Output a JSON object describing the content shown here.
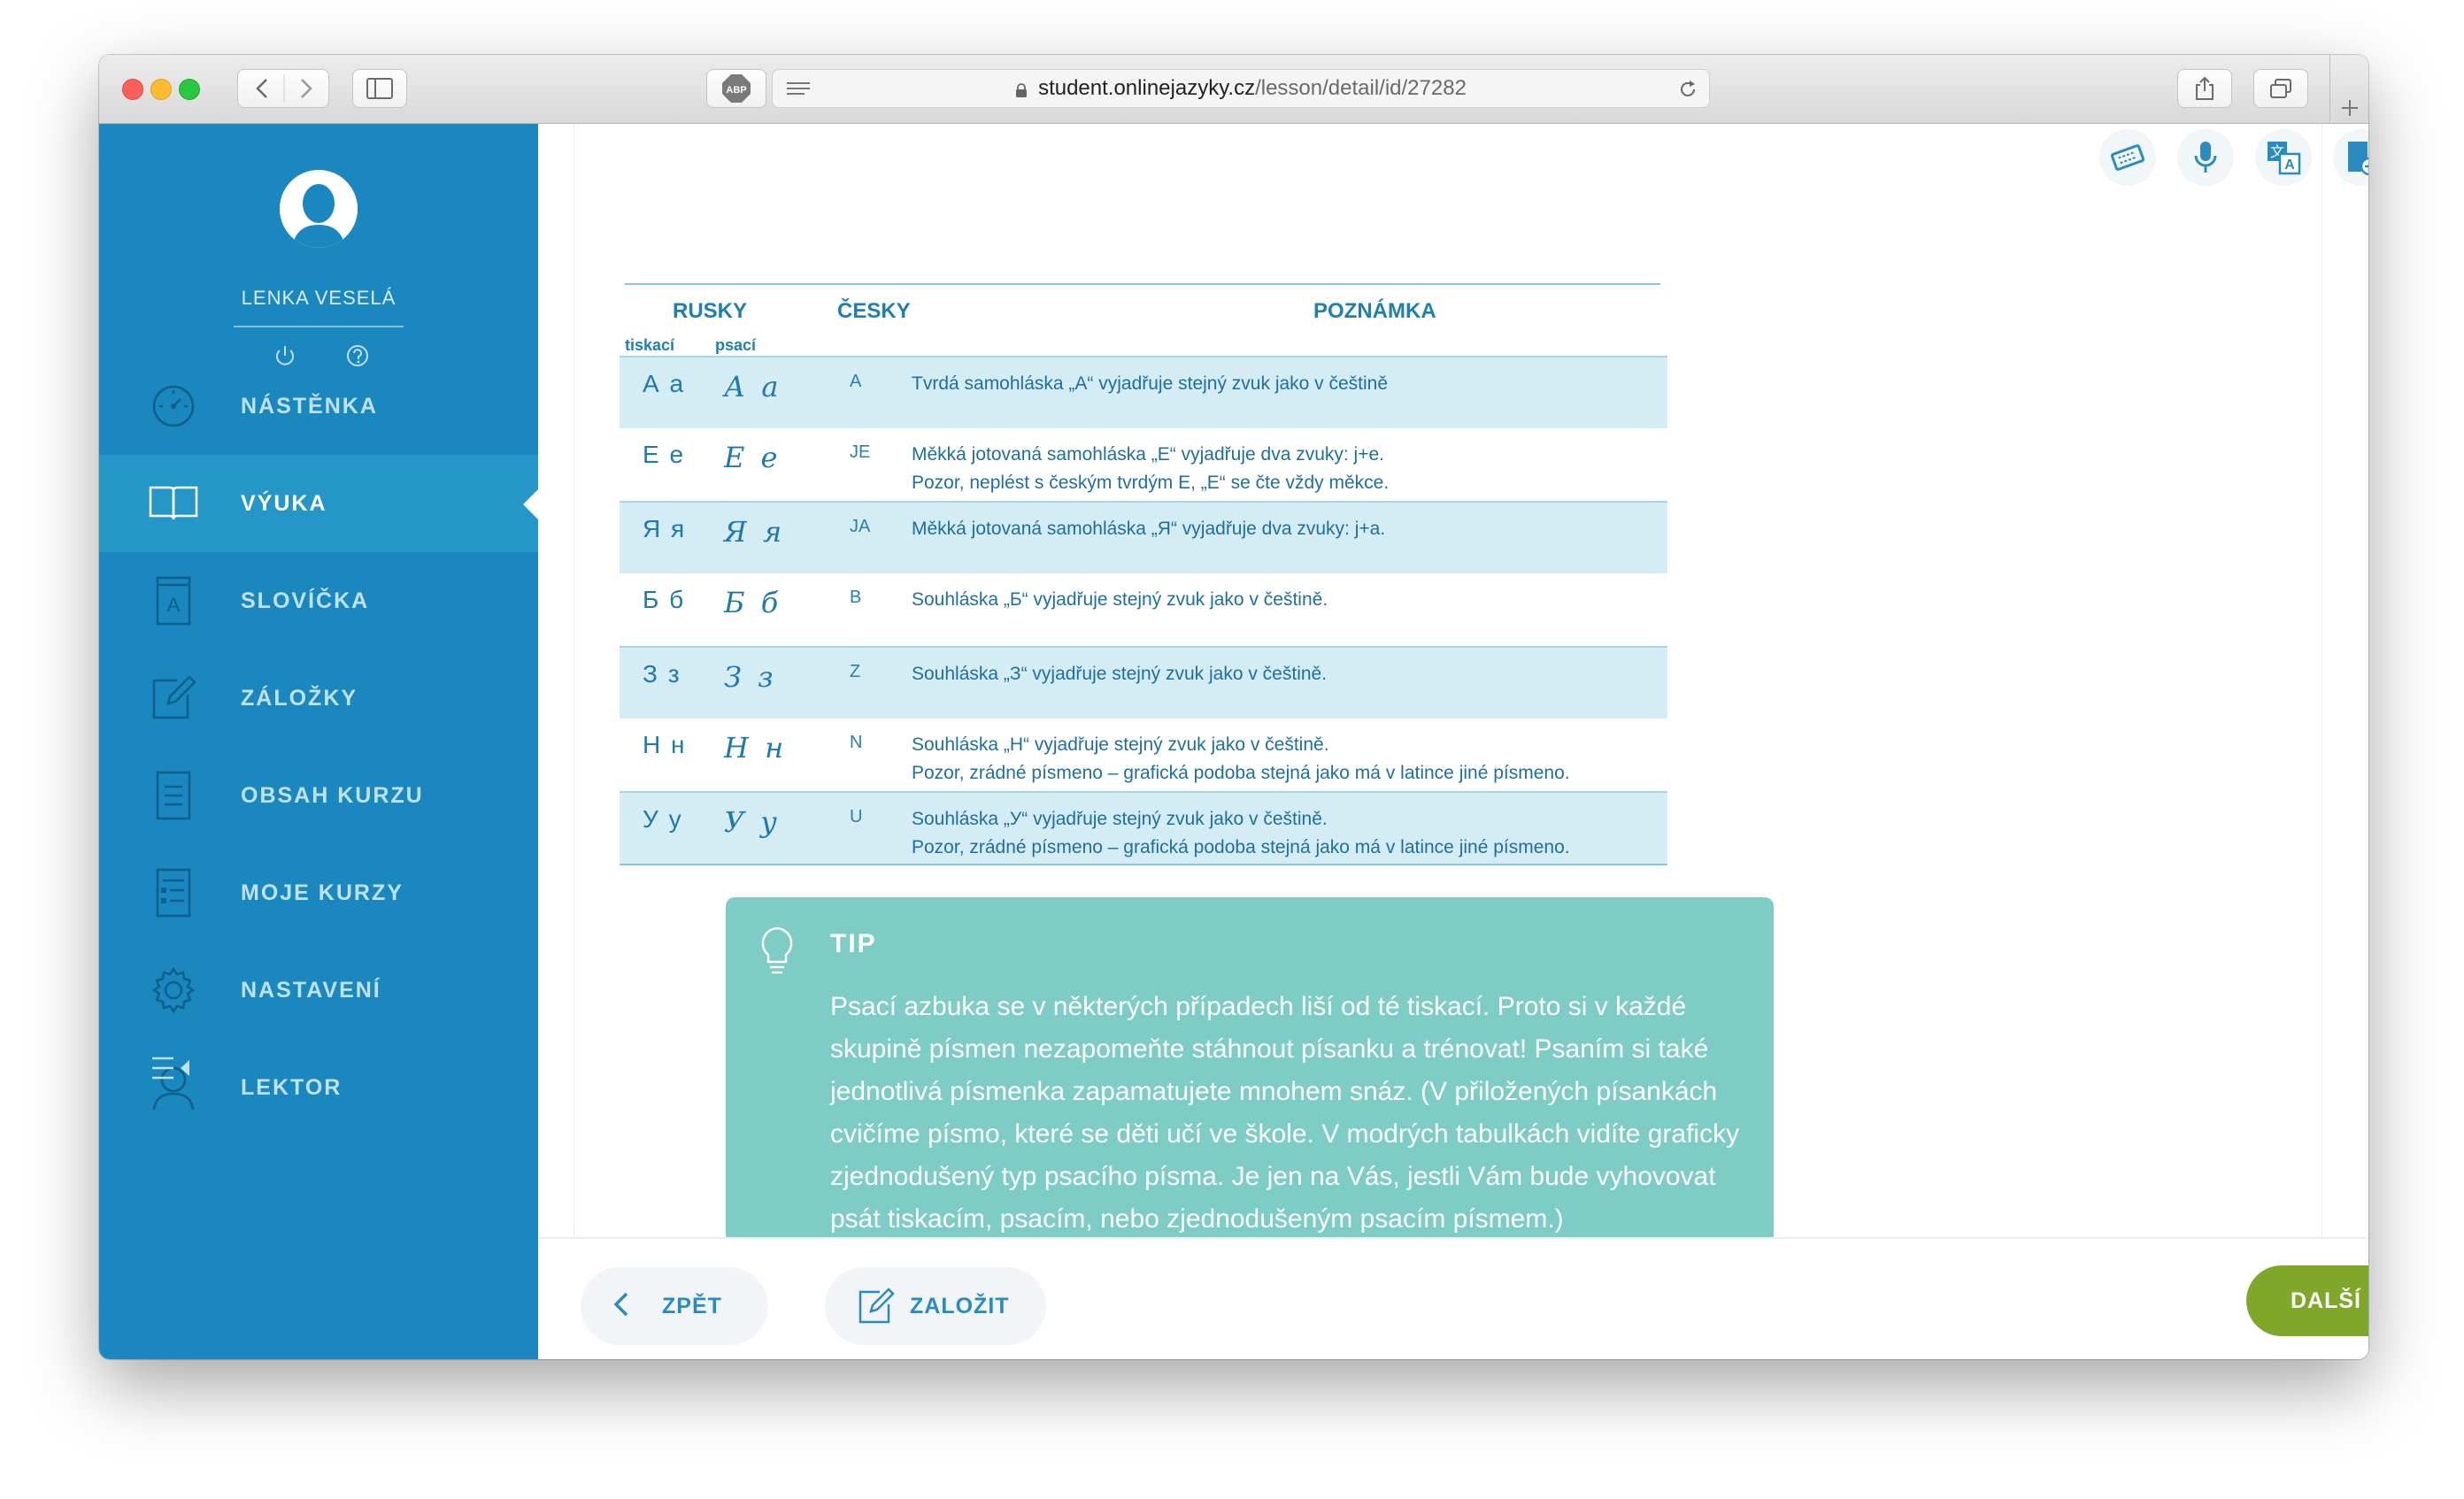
{
  "browser": {
    "url_host": "student.onlinejazyky.cz",
    "url_path": "/lesson/detail/id/27282",
    "adblock_label": "ABP"
  },
  "sidebar": {
    "user_name": "LENKA VESELÁ",
    "items": [
      {
        "label": "NÁSTĚNKA",
        "icon": "dashboard-icon",
        "active": false
      },
      {
        "label": "VÝUKA",
        "icon": "book-icon",
        "active": true
      },
      {
        "label": "SLOVÍČKA",
        "icon": "vocabulary-icon",
        "active": false
      },
      {
        "label": "ZÁLOŽKY",
        "icon": "bookmark-edit-icon",
        "active": false
      },
      {
        "label": "OBSAH KURZU",
        "icon": "document-icon",
        "active": false
      },
      {
        "label": "MOJE KURZY",
        "icon": "list-icon",
        "active": false
      },
      {
        "label": "NASTAVENÍ",
        "icon": "gear-icon",
        "active": false
      },
      {
        "label": "LEKTOR",
        "icon": "user-icon",
        "active": false
      }
    ]
  },
  "alphabet": {
    "headers": {
      "rusky": "RUSKY",
      "cesky": "ČESKY",
      "poznamka": "POZNÁMKA",
      "tiskaci": "tiskací",
      "psaci": "psací"
    },
    "rows": [
      {
        "print": "А а",
        "cursive": "А а",
        "czech": "A",
        "note1": "Tvrdá samohláska „А“ vyjadřuje stejný zvuk jako v češtině",
        "note2": "",
        "shaded": true
      },
      {
        "print": "Е е",
        "cursive": "Е е",
        "czech": "JE",
        "note1": "Měkká jotovaná samohláska „Е“ vyjadřuje dva zvuky: j+e.",
        "note2": "Pozor, neplést s českým tvrdým E, „E“ se čte vždy měkce.",
        "shaded": false
      },
      {
        "print": "Я я",
        "cursive": "Я я",
        "czech": "JA",
        "note1": "Měkká jotovaná samohláska „Я“ vyjadřuje dva zvuky: j+a.",
        "note2": "",
        "shaded": true
      },
      {
        "print": "Б б",
        "cursive": "Б б",
        "czech": "B",
        "note1": "Souhláska „Б“ vyjadřuje stejný zvuk jako v češtině.",
        "note2": "",
        "shaded": false
      },
      {
        "print": "З з",
        "cursive": "З з",
        "czech": "Z",
        "note1": "Souhláska „З“ vyjadřuje stejný zvuk jako v češtině.",
        "note2": "",
        "shaded": true
      },
      {
        "print": "Н н",
        "cursive": "Н н",
        "czech": "N",
        "note1": "Souhláska „Н“ vyjadřuje stejný zvuk jako v češtině.",
        "note2": "Pozor, zrádné písmeno – grafická podoba stejná jako má v latince jiné písmeno.",
        "shaded": false
      },
      {
        "print": "У у",
        "cursive": "У у",
        "czech": "U",
        "note1": "Souhláska „У“ vyjadřuje stejný zvuk jako v češtině.",
        "note2": "Pozor, zrádné písmeno – grafická podoba stejná jako má v latince jiné písmeno.",
        "shaded": true
      }
    ]
  },
  "tip": {
    "title": "TIP",
    "text": "Psací azbuka se v některých případech liší od té tiskací. Proto si v každé skupině písmen nezapomeňte stáhnout písanku a trénovat! Psaním si také jednotlivá písmenka zapamatujete mnohem snáz. (V přiložených písankách cvičíme písmo, které se děti učí ve škole. V modrých tabulkách vidíte graficky zjednodušený typ psacího písma. Je jen na Vás, jestli Vám bude vyhovovat psát tiskacím, psacím, nebo zjednodušeným psacím písmem.)"
  },
  "footer": {
    "back_label": "ZPĚT",
    "save_label": "ZALOŽIT",
    "next_label": "DALŠÍ"
  },
  "colors": {
    "sidebar": "#1a87be",
    "sidebar_active": "#2596c8",
    "accent": "#2a8bc0",
    "tip": "#7dccc5",
    "next_button": "#7fa72a"
  }
}
